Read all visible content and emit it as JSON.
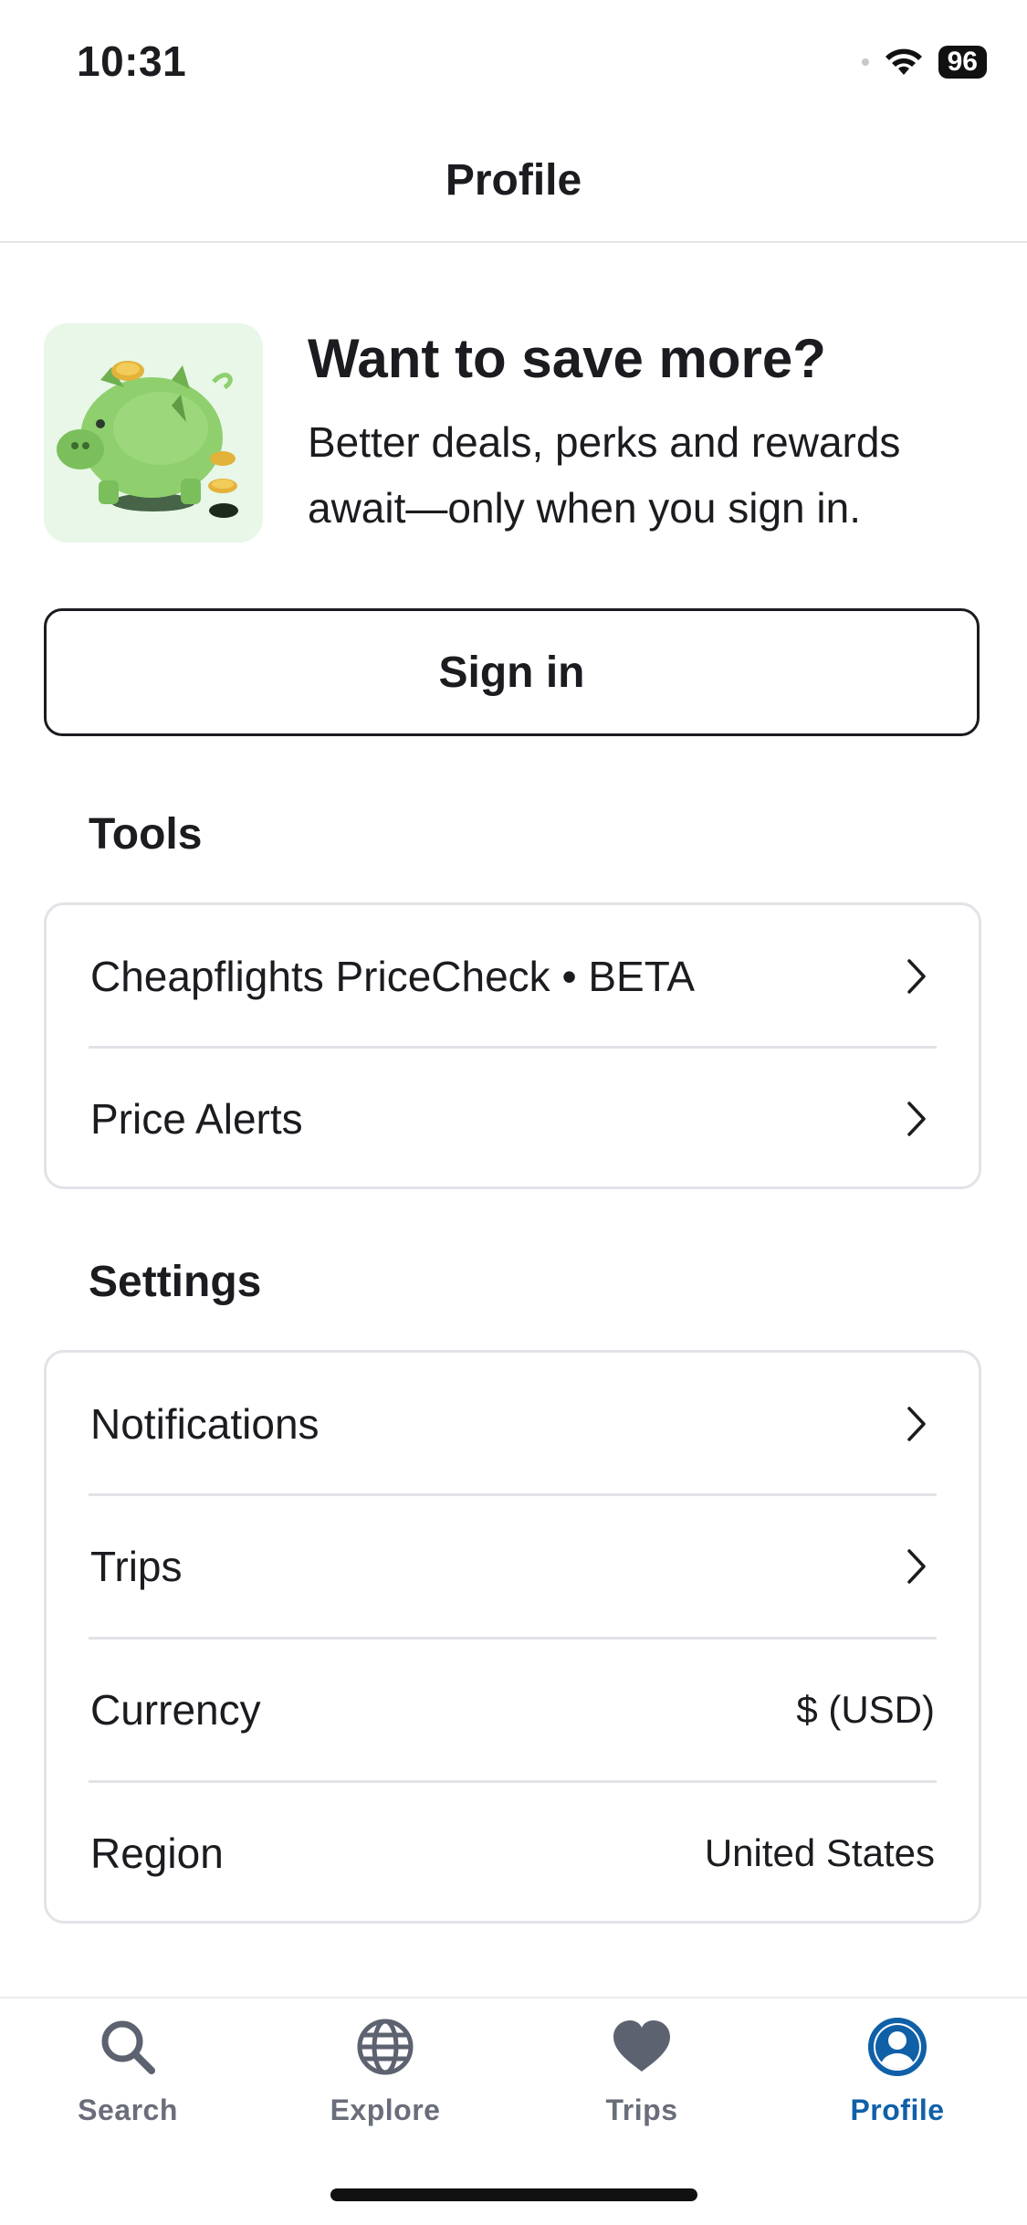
{
  "status_bar": {
    "time": "10:31",
    "battery": "96"
  },
  "header": {
    "title": "Profile"
  },
  "promo": {
    "title": "Want to save more?",
    "body": "Better deals, perks and rewards await—only when you sign in.",
    "image": "piggy-bank-illustration"
  },
  "sign_in_label": "Sign in",
  "tools": {
    "title": "Tools",
    "items": [
      {
        "label": "Cheapflights PriceCheck • BETA"
      },
      {
        "label": "Price Alerts"
      }
    ]
  },
  "settings": {
    "title": "Settings",
    "items": [
      {
        "label": "Notifications"
      },
      {
        "label": "Trips"
      },
      {
        "label": "Currency",
        "value": "$ (USD)"
      },
      {
        "label": "Region",
        "value": "United States"
      }
    ]
  },
  "tabs": [
    {
      "label": "Search",
      "icon": "search-icon"
    },
    {
      "label": "Explore",
      "icon": "globe-icon"
    },
    {
      "label": "Trips",
      "icon": "heart-icon"
    },
    {
      "label": "Profile",
      "icon": "profile-icon",
      "active": true
    }
  ],
  "colors": {
    "accent": "#1060a8",
    "inactive": "#6a6e7a",
    "promo_bg": "#e8f7e8"
  }
}
